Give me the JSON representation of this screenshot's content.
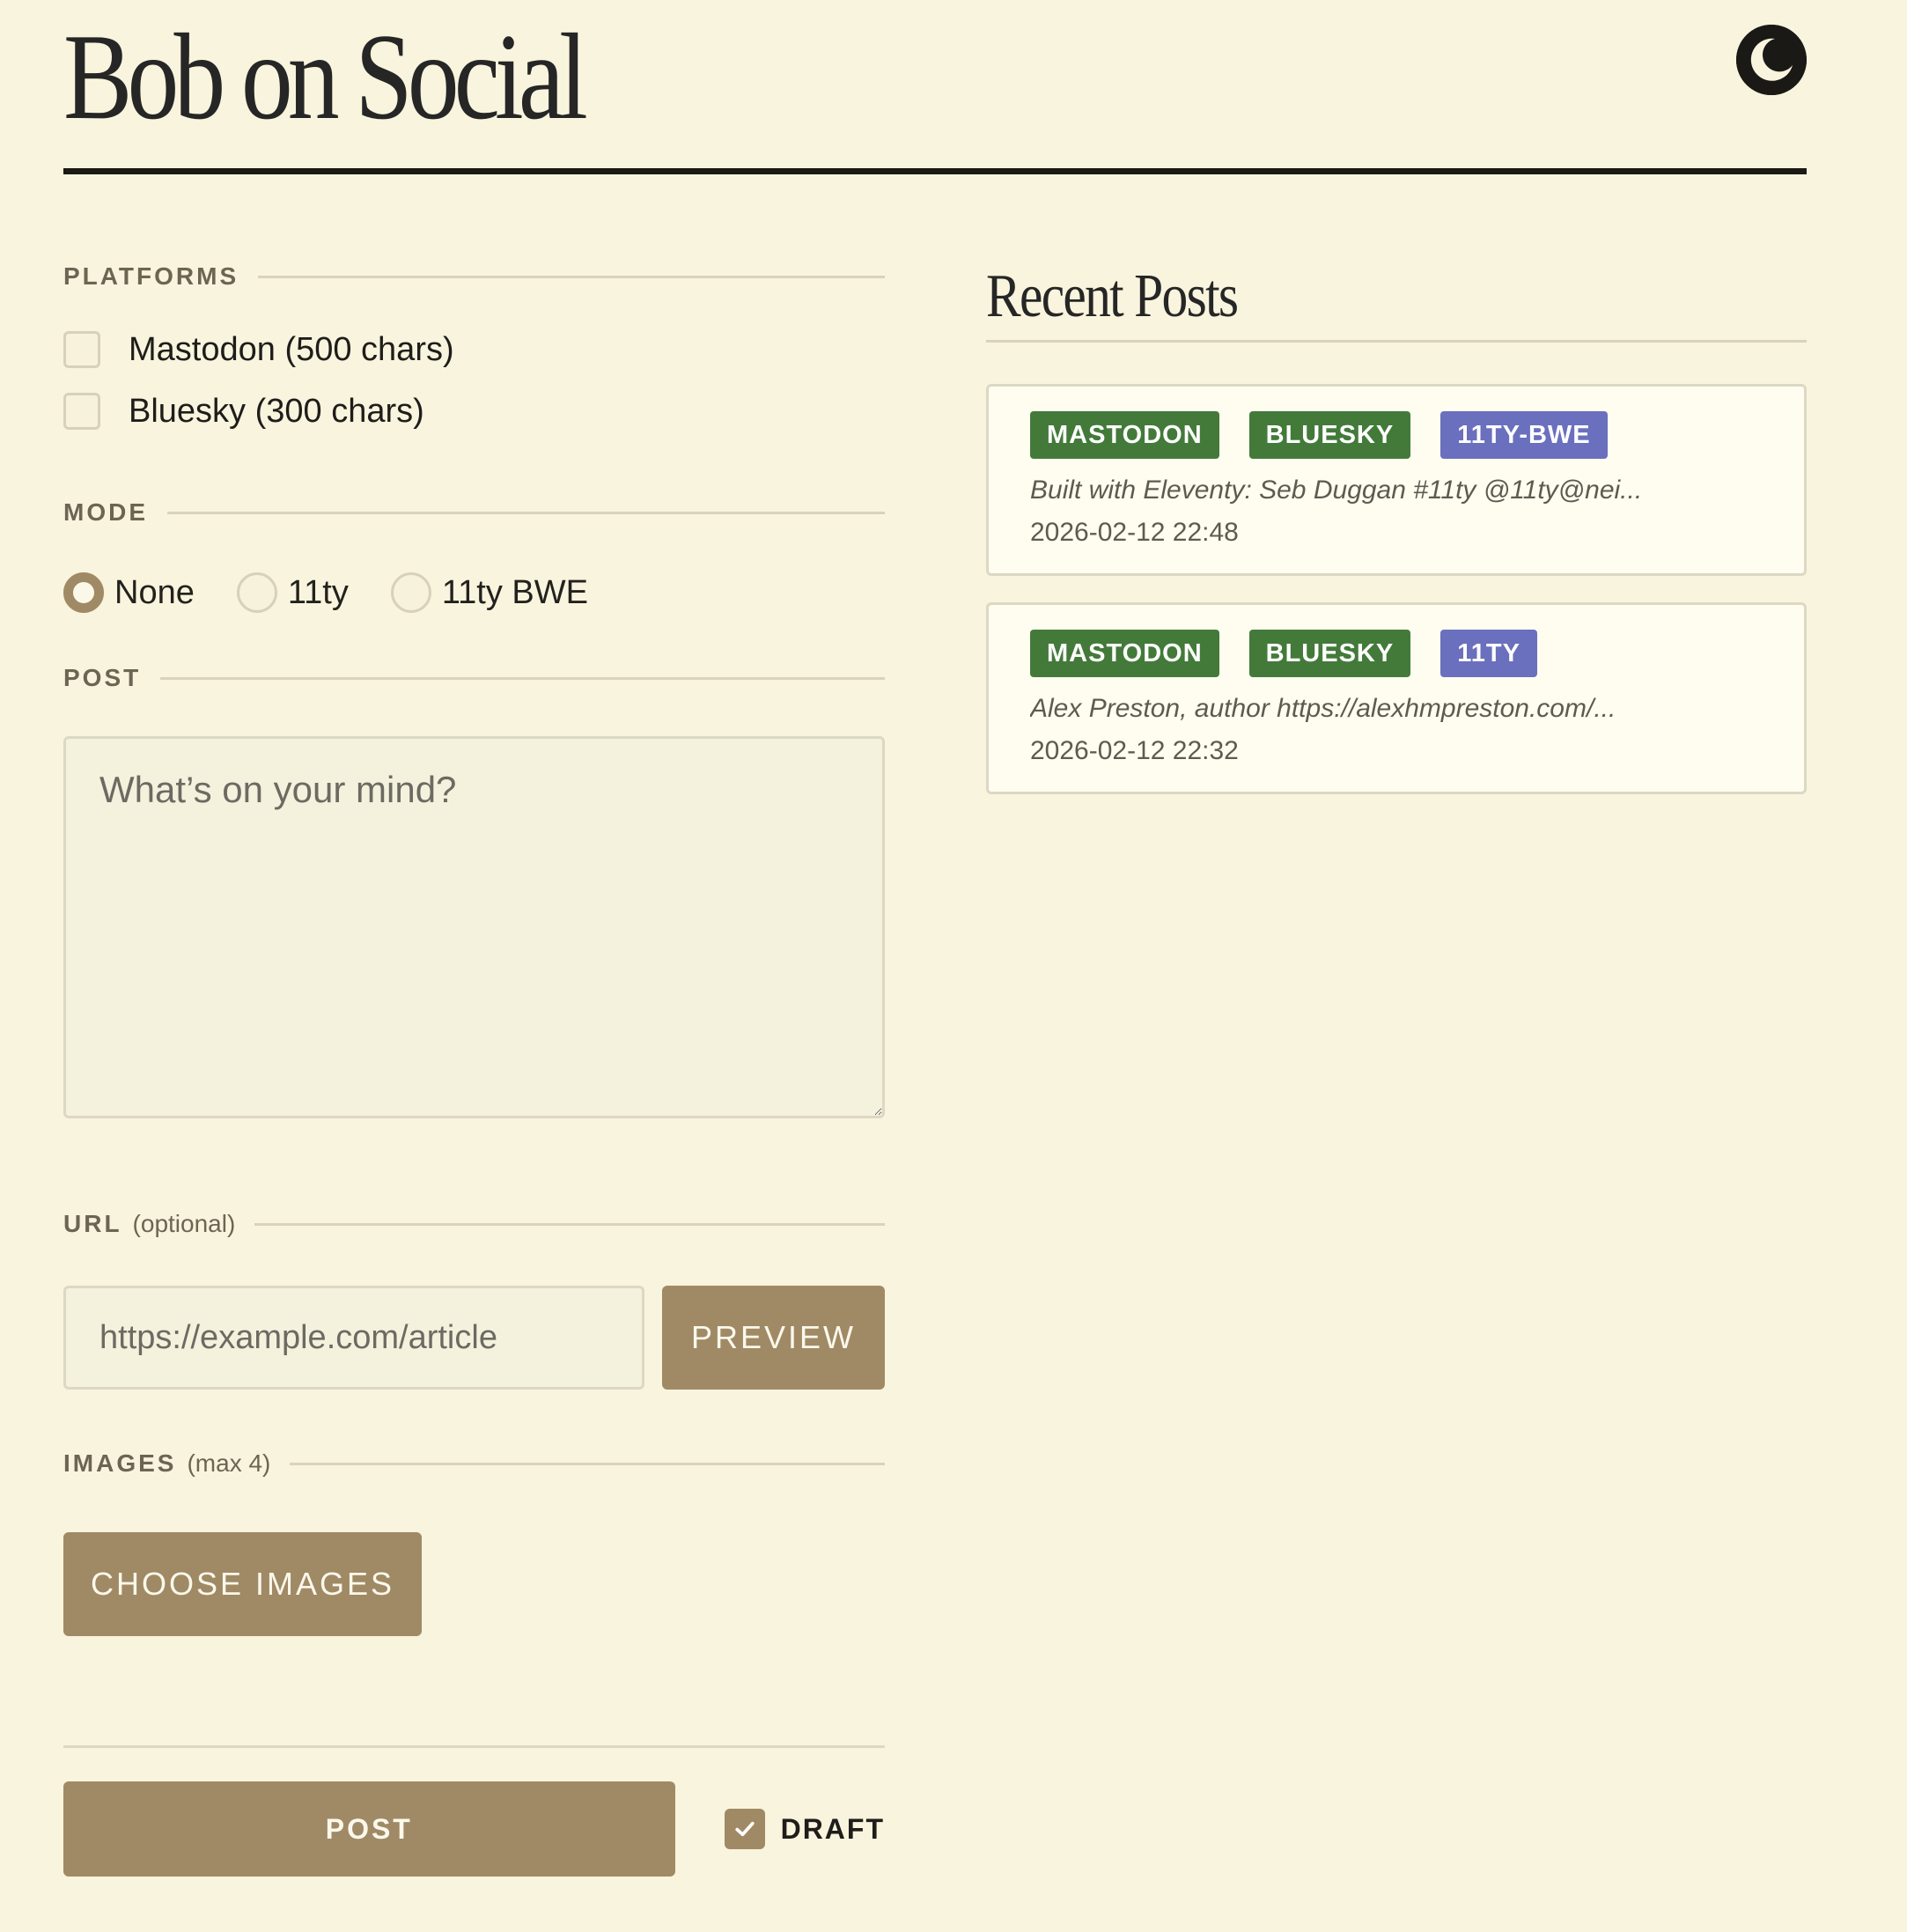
{
  "header": {
    "title": "Bob on Social",
    "theme_toggle_icon": "moon-icon"
  },
  "form": {
    "platforms": {
      "label": "PLATFORMS",
      "options": [
        {
          "label": "Mastodon (500 chars)",
          "checked": false
        },
        {
          "label": "Bluesky (300 chars)",
          "checked": false
        }
      ]
    },
    "mode": {
      "label": "MODE",
      "options": [
        {
          "label": "None",
          "checked": true
        },
        {
          "label": "11ty",
          "checked": false
        },
        {
          "label": "11ty BWE",
          "checked": false
        }
      ]
    },
    "post": {
      "label": "POST",
      "placeholder": "What’s on your mind?",
      "value": ""
    },
    "url": {
      "label": "URL",
      "sublabel": "(optional)",
      "placeholder": "https://example.com/article",
      "value": "",
      "preview_label": "PREVIEW"
    },
    "images": {
      "label": "IMAGES",
      "sublabel": "(max 4)",
      "choose_label": "CHOOSE IMAGES"
    },
    "submit": {
      "post_label": "POST",
      "draft_label": "DRAFT",
      "draft_checked": true
    }
  },
  "recent": {
    "title": "Recent Posts",
    "posts": [
      {
        "tags": [
          {
            "label": "MASTODON",
            "color": "#437a3a"
          },
          {
            "label": "BLUESKY",
            "color": "#437a3a"
          },
          {
            "label": "11TY-BWE",
            "color": "#6a6fbe"
          }
        ],
        "excerpt": "Built with Eleventy: Seb Duggan #11ty @11ty@nei...",
        "timestamp": "2026-02-12 22:48"
      },
      {
        "tags": [
          {
            "label": "MASTODON",
            "color": "#437a3a"
          },
          {
            "label": "BLUESKY",
            "color": "#437a3a"
          },
          {
            "label": "11TY",
            "color": "#6a6fbe"
          }
        ],
        "excerpt": "Alex Preston, author https://alexhmpreston.com/...",
        "timestamp": "2026-02-12 22:32"
      }
    ]
  },
  "colors": {
    "background": "#f9f4dd",
    "accent": "#a08a65",
    "tag_green": "#437a3a",
    "tag_purple": "#6a6fbe"
  }
}
